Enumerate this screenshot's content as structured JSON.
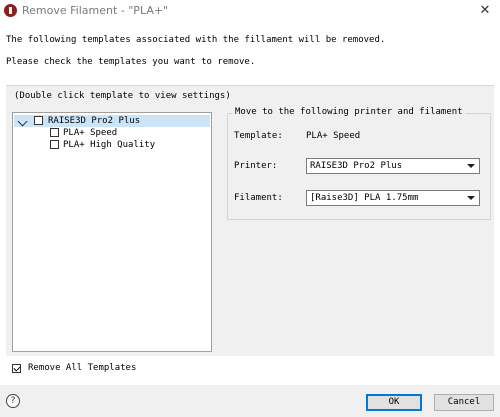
{
  "window": {
    "title": "Remove Filament - \"PLA+\"",
    "close_glyph": "✕"
  },
  "messages": {
    "line1": "The following templates associated with the fillament will be removed.",
    "line2": "Please check the templates you want to remove."
  },
  "tree": {
    "hint": "(Double click template to view settings)",
    "root": {
      "label": "RAISE3D Pro2 Plus",
      "checked": false,
      "expanded": true
    },
    "children": [
      {
        "label": "PLA+ Speed",
        "checked": false
      },
      {
        "label": "PLA+ High Quality",
        "checked": false
      }
    ]
  },
  "move_panel": {
    "legend": "Move to the following printer and filament",
    "template_label": "Template:",
    "template_value": "PLA+ Speed",
    "printer_label": "Printer:",
    "printer_value": "RAISE3D Pro2 Plus",
    "filament_label": "Filament:",
    "filament_value": "[Raise3D] PLA 1.75mm"
  },
  "remove_all": {
    "label": "Remove All Templates",
    "checked": true
  },
  "buttons": {
    "ok": "OK",
    "cancel": "Cancel",
    "help_glyph": "?"
  },
  "colors": {
    "selection": "#cce4f7",
    "default_button_border": "#0078d7",
    "app_icon": "#8a1f1f"
  },
  "icons": {
    "app": "raise3d-logo-icon",
    "help": "help-icon",
    "close": "close-icon"
  }
}
